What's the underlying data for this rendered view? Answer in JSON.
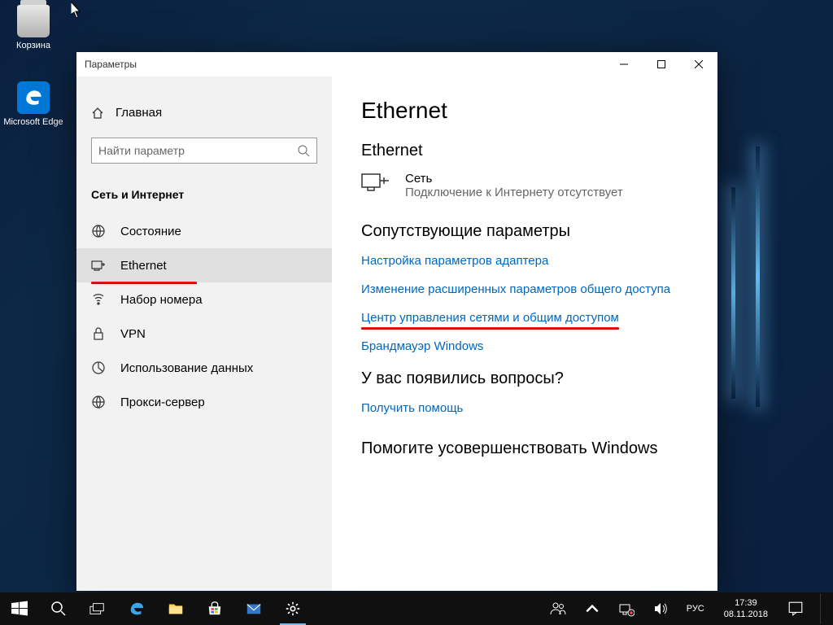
{
  "desktop": {
    "recycle_bin": "Корзина",
    "edge": "Microsoft Edge"
  },
  "window": {
    "title": "Параметры",
    "home": "Главная",
    "search_placeholder": "Найти параметр",
    "section": "Сеть и Интернет",
    "nav": [
      {
        "label": "Состояние"
      },
      {
        "label": "Ethernet"
      },
      {
        "label": "Набор номера"
      },
      {
        "label": "VPN"
      },
      {
        "label": "Использование данных"
      },
      {
        "label": "Прокси-сервер"
      }
    ]
  },
  "content": {
    "title": "Ethernet",
    "subtitle": "Ethernet",
    "net_name": "Сеть",
    "net_status": "Подключение к Интернету отсутствует",
    "related_head": "Сопутствующие параметры",
    "links": [
      "Настройка параметров адаптера",
      "Изменение расширенных параметров общего доступа",
      "Центр управления сетями и общим доступом",
      "Брандмауэр Windows"
    ],
    "questions_head": "У вас появились вопросы?",
    "get_help": "Получить помощь",
    "improve_head": "Помогите усовершенствовать Windows"
  },
  "taskbar": {
    "lang": "РУС",
    "time": "17:39",
    "date": "08.11.2018"
  }
}
